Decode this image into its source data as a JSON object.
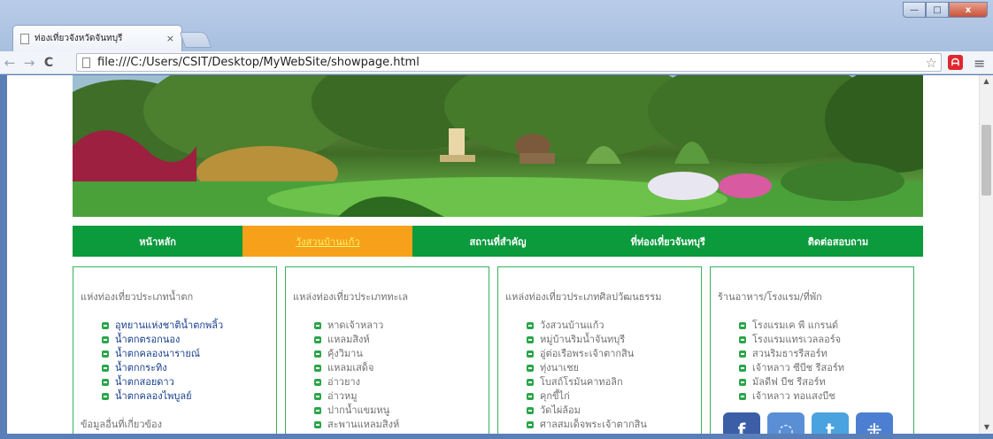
{
  "browser": {
    "tab_title": "ท่องเที่ยวจังหวัดจันทบุรี",
    "tab_close": "×",
    "url": "file:///C:/Users/CSIT/Desktop/MyWebSite/showpage.html",
    "win_min": "—",
    "win_max": "□",
    "win_close": "x"
  },
  "nav": [
    {
      "label": "หน้าหลัก"
    },
    {
      "label": "วังสวนบ้านแก้ว",
      "active": true
    },
    {
      "label": "สถานที่สำคัญ"
    },
    {
      "label": "ที่ท่องเที่ยวจันทบุรี"
    },
    {
      "label": "ติดต่อสอบถาม"
    }
  ],
  "boxes": {
    "waterfall": {
      "title": "แห่งท่องเที่ยวประเภทน้ำตก",
      "items": [
        "อุทยานแห่งชาติน้ำตกพลิ้ว",
        "น้ำตกตรอกนอง",
        "น้ำตกคลองนารายณ์",
        "น้ำตกกระทิง",
        "น้ำตกสอยดาว",
        "น้ำตกคลองไพบูลย์"
      ],
      "sub_title": "ข้อมูลอื่นที่เกี่ยวข้อง"
    },
    "sea": {
      "title": "แหล่งท่องเที่ยวประเภททะเล",
      "items": [
        "หาดเจ้าหลาว",
        "แหลมสิงห์",
        "คุ้งวิมาน",
        "แหลมเสด็จ",
        "อ่าวยาง",
        "อ่าวหมู",
        "ปากน้ำแขมหนู",
        "สะพานแหลมสิงห์"
      ]
    },
    "culture": {
      "title": "แหล่งท่องเที่ยวประเภทศิลปวัฒนธรรม",
      "items": [
        "วังสวนบ้านแก้ว",
        "หมู่บ้านริมน้ำจันทบุรี",
        "อู่ต่อเรือพระเจ้าตากสิน",
        "ทุ่งนาเชย",
        "โบสถ์โรมันคาทอลิก",
        "คุกขี้ไก่",
        "วัดไผ่ล้อม",
        "ศาลสมเด็จพระเจ้าตากสิน"
      ]
    },
    "food": {
      "title": "ร้านอาหาร/โรงแรม/ที่พัก",
      "items": [
        "โรงแรมเค พี แกรนด์",
        "โรงแรมแทรเวลลอร์จ",
        "สวนริมธารรีสอร์ท",
        "เจ้าหลาว ซีบีช รีสอร์ท",
        "มัลดีฟ บีช รีสอร์ท",
        "เจ้าหลาว ทอแสงบีช"
      ]
    }
  },
  "social_icons": [
    "facebook-icon",
    "picasa-icon",
    "twitter-icon",
    "myspace-icon"
  ],
  "colors": {
    "nav_green": "#0b9a3c",
    "nav_active": "#f7a11a",
    "box_border": "#37b25c",
    "link_blue": "#163e8c"
  }
}
